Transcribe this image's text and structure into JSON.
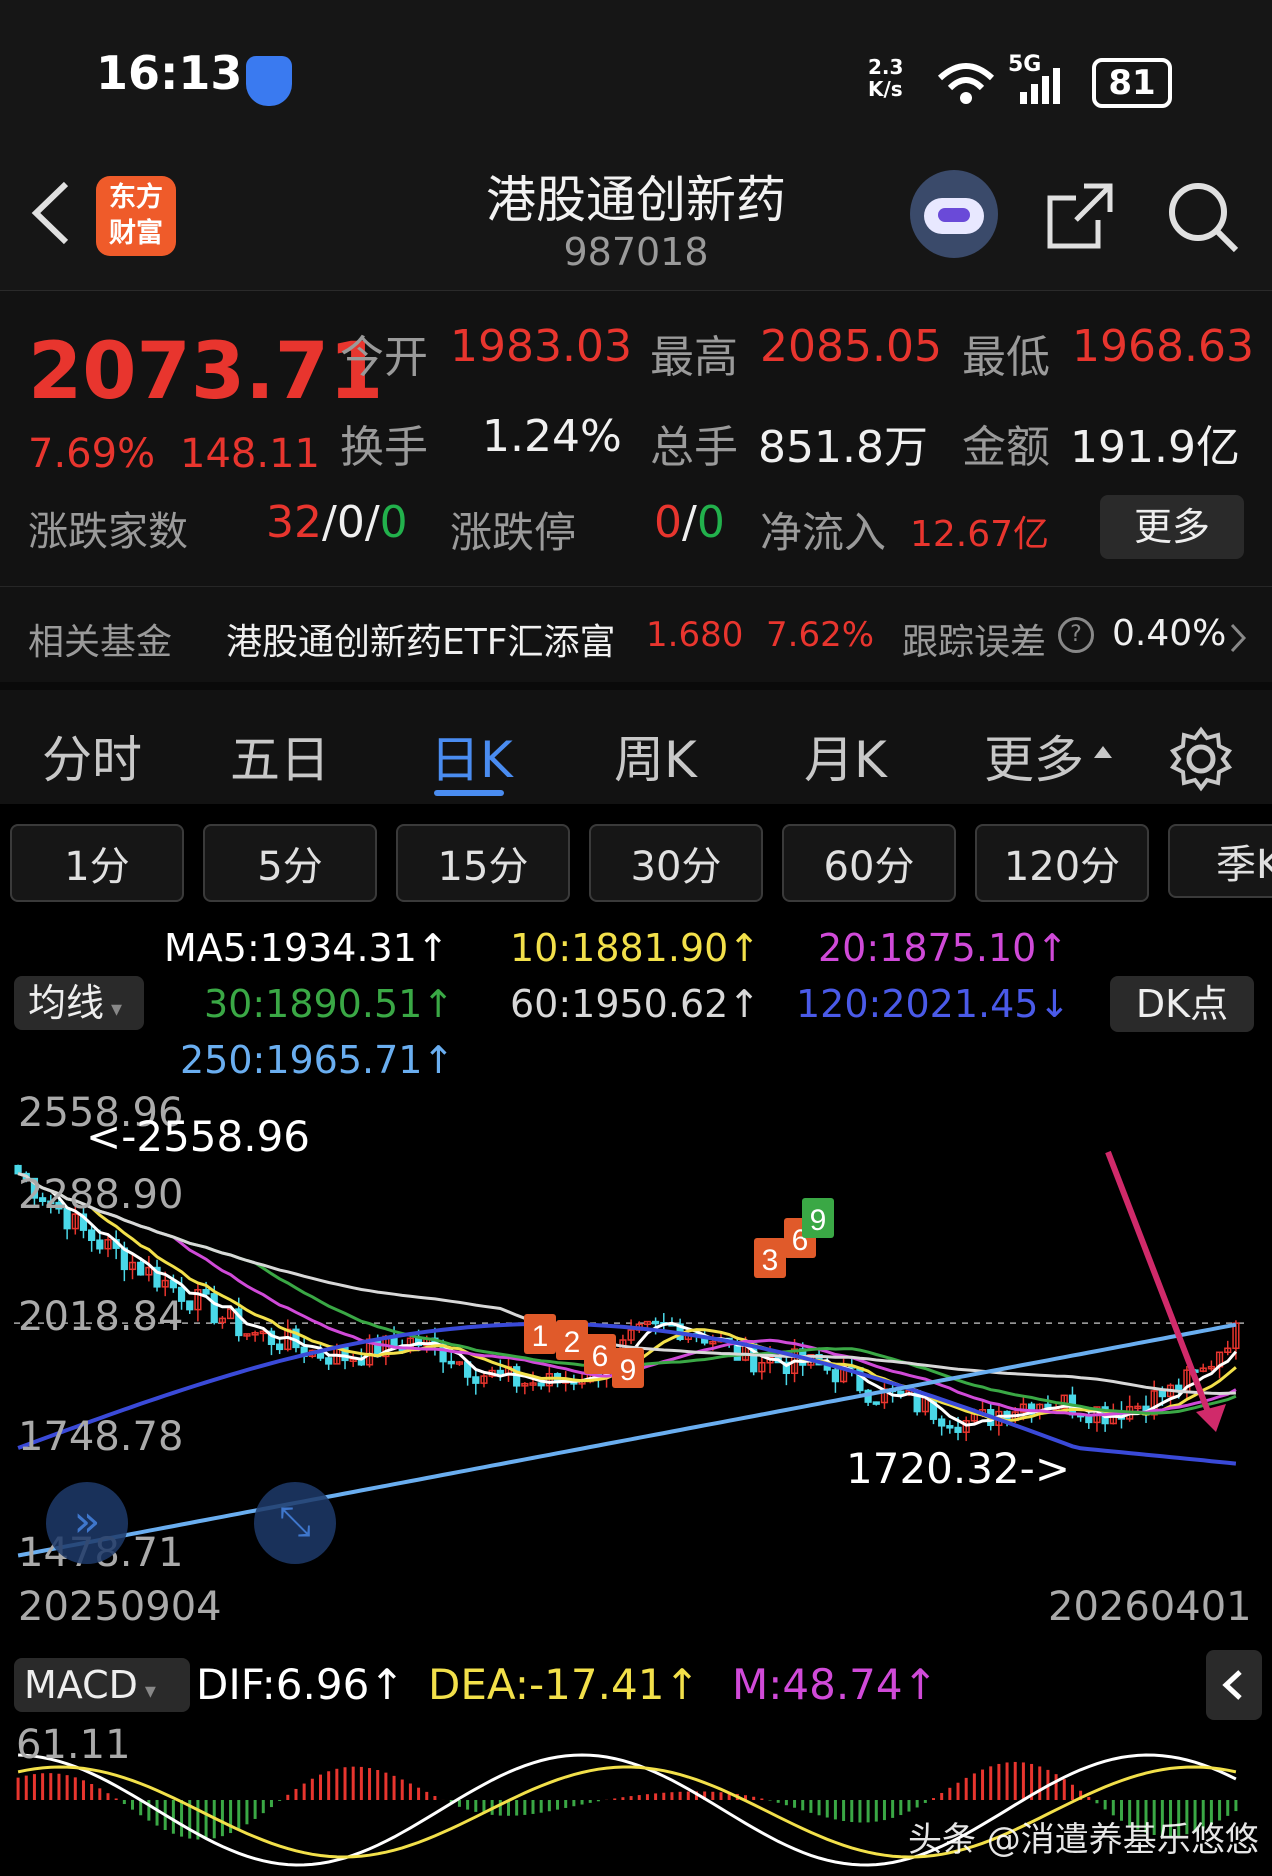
{
  "status": {
    "time": "16:13",
    "net_speed": "2.3\nK/s",
    "wifi": "6",
    "network": "5G",
    "battery": "81"
  },
  "header": {
    "app_logo_text": "东方\n财富",
    "title": "港股通创新药",
    "code": "987018"
  },
  "quote": {
    "price": "2073.71",
    "pct": "7.69%",
    "change": "148.11",
    "open_label": "今开",
    "open": "1983.03",
    "high_label": "最高",
    "high": "2085.05",
    "low_label": "最低",
    "low": "1968.63",
    "turnover_label": "换手",
    "turnover": "1.24%",
    "volume_label": "总手",
    "volume": "851.8万",
    "amount_label": "金额",
    "amount": "191.9亿",
    "breadth_label": "涨跌家数",
    "breadth_up": "32",
    "breadth_sep1": "/",
    "breadth_flat": "0",
    "breadth_sep2": "/",
    "breadth_down": "0",
    "limit_label": "涨跌停",
    "limit_up": "0",
    "limit_sep": "/",
    "limit_down": "0",
    "inflow_label": "净流入",
    "inflow": "12.67亿",
    "more_button": "更多"
  },
  "fund": {
    "label": "相关基金",
    "name": "港股通创新药ETF汇添富",
    "price": "1.680",
    "pct": "7.62%",
    "err_label": "跟踪误差",
    "err": "0.40%"
  },
  "tabs": [
    "分时",
    "五日",
    "日K",
    "周K",
    "月K",
    "更多"
  ],
  "active_tab": 2,
  "minute_buttons": [
    "1分",
    "5分",
    "15分",
    "30分",
    "60分",
    "120分",
    "季K"
  ],
  "ma_selector": "均线",
  "dk_button": "DK点",
  "ma": {
    "ma5": "MA5:1934.31↑",
    "ma10": "10:1881.90↑",
    "ma20": "20:1875.10↑",
    "ma30": "30:1890.51↑",
    "ma60": "60:1950.62↑",
    "ma120": "120:2021.45↓",
    "ma250": "250:1965.71↑"
  },
  "colors": {
    "up": "#e8352e",
    "down": "#22b14c",
    "ma5": "#ffffff",
    "ma10": "#f2e04a",
    "ma20": "#d04ad8",
    "ma30": "#3aa845",
    "ma60": "#d8d8d8",
    "ma120": "#3a4ad8",
    "ma250": "#6aaef0",
    "blue_tab": "#4a8cf0",
    "arrow": "#d02a6a"
  },
  "chart_data": {
    "type": "candlestick",
    "y_ticks": [
      "2558.96",
      "2288.90",
      "2018.84",
      "1748.78",
      "1478.71"
    ],
    "ylim": [
      1478.71,
      2558.96
    ],
    "x_start": "20250904",
    "x_end": "20260401",
    "annotations": {
      "max_label": "<-2558.96",
      "min_label": "1720.32->"
    },
    "last_close": 2073.71
  },
  "macd": {
    "selector": "MACD",
    "dif": "DIF:6.96↑",
    "dea": "DEA:-17.41↑",
    "m": "M:48.74↑",
    "y_top": "61.11"
  },
  "watermark": "头条 @消遣养基乐悠悠"
}
